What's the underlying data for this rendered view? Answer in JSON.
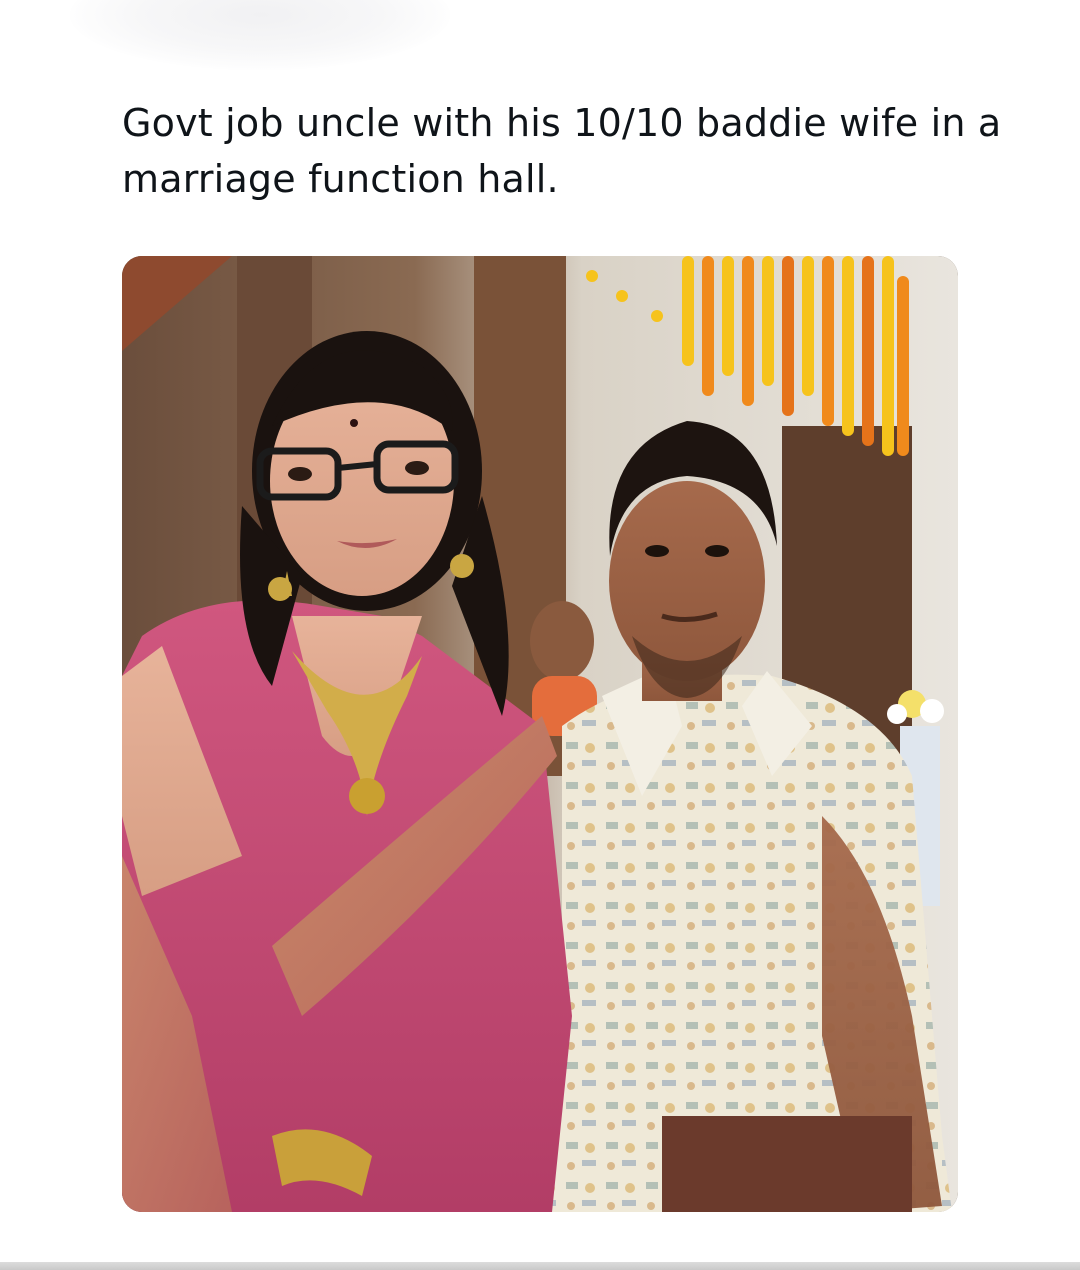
{
  "post": {
    "text": "Govt job uncle with his 10/10 baddie wife in a marriage function hall."
  },
  "image": {
    "subject": "couple-photo",
    "accent_colors": {
      "saree": "#c24a74",
      "marigold_orange": "#f08a1c",
      "marigold_yellow": "#f6c31c",
      "shirt": "#efe9d8",
      "background_wall": "#7a5b45"
    }
  }
}
